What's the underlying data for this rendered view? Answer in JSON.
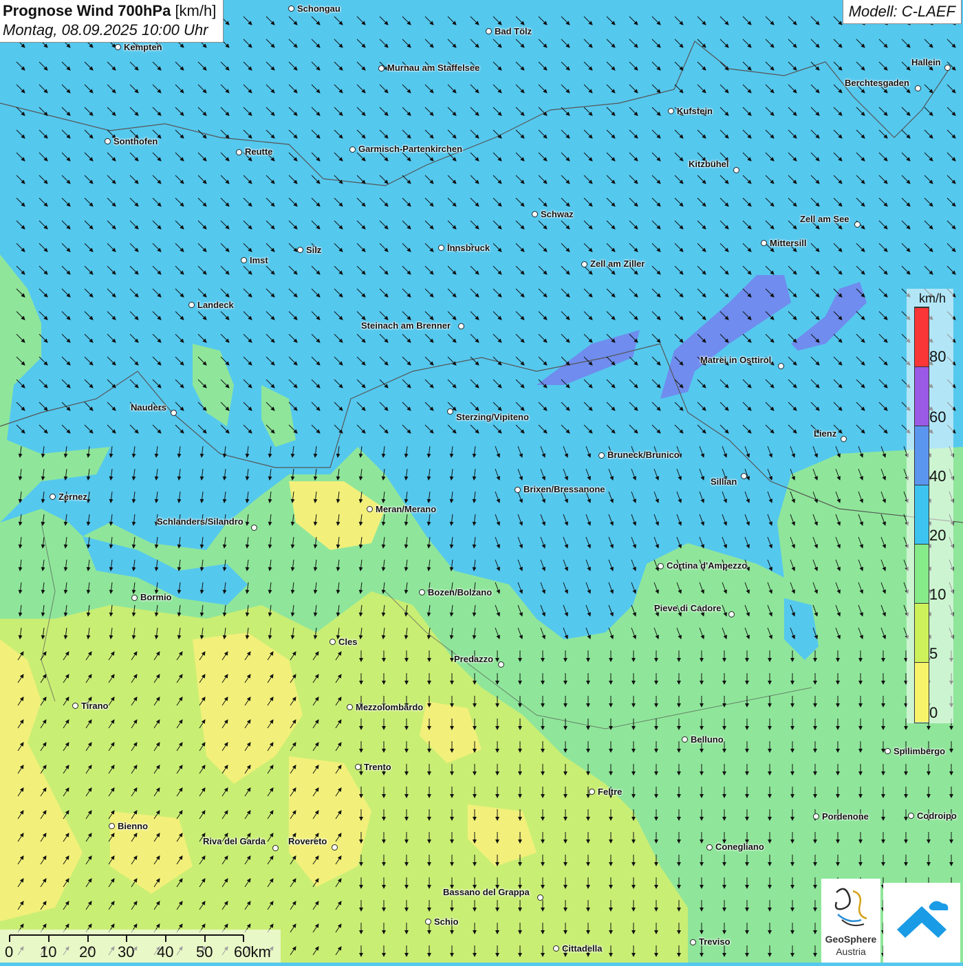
{
  "header": {
    "title_bold": "Prognose Wind 700hPa",
    "title_unit": "[km/h]",
    "datetime": "Montag, 08.09.2025 10:00 Uhr"
  },
  "model_label": "Modell: C-LAEF",
  "legend": {
    "unit": "km/h",
    "labels": [
      "80",
      "60",
      "40",
      "20",
      "10",
      "5",
      "0"
    ],
    "colors": {
      "c80": "#fa3636",
      "c60": "#9a5ae6",
      "c40": "#5a96ee",
      "c20": "#3cc3f0",
      "c10": "#86ec8a",
      "c5": "#cdf15a",
      "c0": "#f7f36a"
    }
  },
  "scalebar": {
    "labels": [
      "0",
      "10",
      "20",
      "30",
      "40",
      "50",
      "60km"
    ]
  },
  "cities": [
    {
      "name": "Schongau"
    },
    {
      "name": "Bad Tölz"
    },
    {
      "name": "Kempten"
    },
    {
      "name": "Murnau am Staffelsee"
    },
    {
      "name": "Hallein"
    },
    {
      "name": "Berchtesgaden"
    },
    {
      "name": "Kufstein"
    },
    {
      "name": "Sonthofen"
    },
    {
      "name": "Reutte"
    },
    {
      "name": "Garmisch-Partenkirchen"
    },
    {
      "name": "Kitzbühel"
    },
    {
      "name": "Schwaz"
    },
    {
      "name": "Zell am See"
    },
    {
      "name": "Innsbruck"
    },
    {
      "name": "Silz"
    },
    {
      "name": "Mittersill"
    },
    {
      "name": "Imst"
    },
    {
      "name": "Zell am Ziller"
    },
    {
      "name": "Landeck"
    },
    {
      "name": "Steinach am Brenner"
    },
    {
      "name": "Matrei in Osttirol"
    },
    {
      "name": "Nauders"
    },
    {
      "name": "Sterzing/Vipiteno"
    },
    {
      "name": "Lienz"
    },
    {
      "name": "Bruneck/Brunico"
    },
    {
      "name": "Sillian"
    },
    {
      "name": "Zernez"
    },
    {
      "name": "Brixen/Bressanone"
    },
    {
      "name": "Meran/Merano"
    },
    {
      "name": "Schlanders/Silandro"
    },
    {
      "name": "Cortina d'Ampezzo"
    },
    {
      "name": "Bozen/Bolzano"
    },
    {
      "name": "Bormio"
    },
    {
      "name": "Pieve di Cadore"
    },
    {
      "name": "Cles"
    },
    {
      "name": "Predazzo"
    },
    {
      "name": "Tirano"
    },
    {
      "name": "Mezzolombardo"
    },
    {
      "name": "Belluno"
    },
    {
      "name": "Spilimbergo"
    },
    {
      "name": "Trento"
    },
    {
      "name": "Feltre"
    },
    {
      "name": "Pordenone"
    },
    {
      "name": "Codroipo"
    },
    {
      "name": "Bienno"
    },
    {
      "name": "Riva del Garda"
    },
    {
      "name": "Rovereto"
    },
    {
      "name": "Conegliano"
    },
    {
      "name": "Bassano del Grappa"
    },
    {
      "name": "Schio"
    },
    {
      "name": "Treviso"
    },
    {
      "name": "Cittadella"
    }
  ],
  "logos": {
    "geosphere_name": "GeoSphere",
    "geosphere_sub": "Austria"
  }
}
